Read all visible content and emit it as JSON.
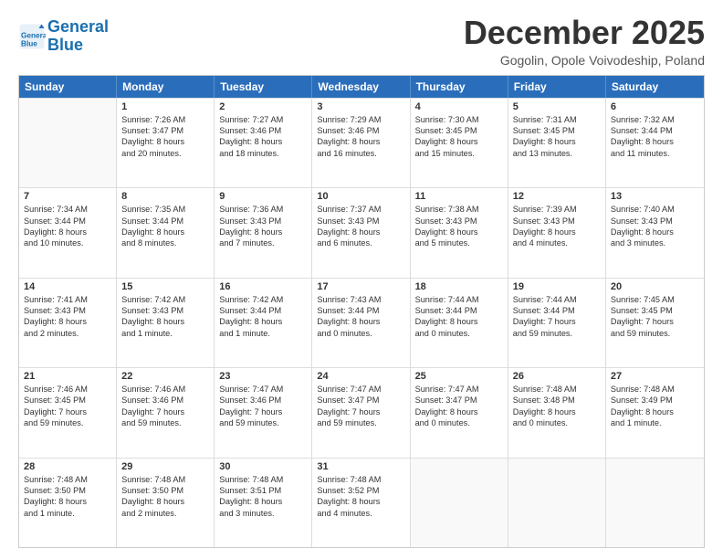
{
  "logo": {
    "line1": "General",
    "line2": "Blue"
  },
  "title": "December 2025",
  "location": "Gogolin, Opole Voivodeship, Poland",
  "days": [
    "Sunday",
    "Monday",
    "Tuesday",
    "Wednesday",
    "Thursday",
    "Friday",
    "Saturday"
  ],
  "weeks": [
    [
      {
        "day": "",
        "sunrise": "",
        "sunset": "",
        "daylight": ""
      },
      {
        "day": "1",
        "sunrise": "Sunrise: 7:26 AM",
        "sunset": "Sunset: 3:47 PM",
        "daylight": "Daylight: 8 hours",
        "daylight2": "and 20 minutes."
      },
      {
        "day": "2",
        "sunrise": "Sunrise: 7:27 AM",
        "sunset": "Sunset: 3:46 PM",
        "daylight": "Daylight: 8 hours",
        "daylight2": "and 18 minutes."
      },
      {
        "day": "3",
        "sunrise": "Sunrise: 7:29 AM",
        "sunset": "Sunset: 3:46 PM",
        "daylight": "Daylight: 8 hours",
        "daylight2": "and 16 minutes."
      },
      {
        "day": "4",
        "sunrise": "Sunrise: 7:30 AM",
        "sunset": "Sunset: 3:45 PM",
        "daylight": "Daylight: 8 hours",
        "daylight2": "and 15 minutes."
      },
      {
        "day": "5",
        "sunrise": "Sunrise: 7:31 AM",
        "sunset": "Sunset: 3:45 PM",
        "daylight": "Daylight: 8 hours",
        "daylight2": "and 13 minutes."
      },
      {
        "day": "6",
        "sunrise": "Sunrise: 7:32 AM",
        "sunset": "Sunset: 3:44 PM",
        "daylight": "Daylight: 8 hours",
        "daylight2": "and 11 minutes."
      }
    ],
    [
      {
        "day": "7",
        "sunrise": "Sunrise: 7:34 AM",
        "sunset": "Sunset: 3:44 PM",
        "daylight": "Daylight: 8 hours",
        "daylight2": "and 10 minutes."
      },
      {
        "day": "8",
        "sunrise": "Sunrise: 7:35 AM",
        "sunset": "Sunset: 3:44 PM",
        "daylight": "Daylight: 8 hours",
        "daylight2": "and 8 minutes."
      },
      {
        "day": "9",
        "sunrise": "Sunrise: 7:36 AM",
        "sunset": "Sunset: 3:43 PM",
        "daylight": "Daylight: 8 hours",
        "daylight2": "and 7 minutes."
      },
      {
        "day": "10",
        "sunrise": "Sunrise: 7:37 AM",
        "sunset": "Sunset: 3:43 PM",
        "daylight": "Daylight: 8 hours",
        "daylight2": "and 6 minutes."
      },
      {
        "day": "11",
        "sunrise": "Sunrise: 7:38 AM",
        "sunset": "Sunset: 3:43 PM",
        "daylight": "Daylight: 8 hours",
        "daylight2": "and 5 minutes."
      },
      {
        "day": "12",
        "sunrise": "Sunrise: 7:39 AM",
        "sunset": "Sunset: 3:43 PM",
        "daylight": "Daylight: 8 hours",
        "daylight2": "and 4 minutes."
      },
      {
        "day": "13",
        "sunrise": "Sunrise: 7:40 AM",
        "sunset": "Sunset: 3:43 PM",
        "daylight": "Daylight: 8 hours",
        "daylight2": "and 3 minutes."
      }
    ],
    [
      {
        "day": "14",
        "sunrise": "Sunrise: 7:41 AM",
        "sunset": "Sunset: 3:43 PM",
        "daylight": "Daylight: 8 hours",
        "daylight2": "and 2 minutes."
      },
      {
        "day": "15",
        "sunrise": "Sunrise: 7:42 AM",
        "sunset": "Sunset: 3:43 PM",
        "daylight": "Daylight: 8 hours",
        "daylight2": "and 1 minute."
      },
      {
        "day": "16",
        "sunrise": "Sunrise: 7:42 AM",
        "sunset": "Sunset: 3:44 PM",
        "daylight": "Daylight: 8 hours",
        "daylight2": "and 1 minute."
      },
      {
        "day": "17",
        "sunrise": "Sunrise: 7:43 AM",
        "sunset": "Sunset: 3:44 PM",
        "daylight": "Daylight: 8 hours",
        "daylight2": "and 0 minutes."
      },
      {
        "day": "18",
        "sunrise": "Sunrise: 7:44 AM",
        "sunset": "Sunset: 3:44 PM",
        "daylight": "Daylight: 8 hours",
        "daylight2": "and 0 minutes."
      },
      {
        "day": "19",
        "sunrise": "Sunrise: 7:44 AM",
        "sunset": "Sunset: 3:44 PM",
        "daylight": "Daylight: 7 hours",
        "daylight2": "and 59 minutes."
      },
      {
        "day": "20",
        "sunrise": "Sunrise: 7:45 AM",
        "sunset": "Sunset: 3:45 PM",
        "daylight": "Daylight: 7 hours",
        "daylight2": "and 59 minutes."
      }
    ],
    [
      {
        "day": "21",
        "sunrise": "Sunrise: 7:46 AM",
        "sunset": "Sunset: 3:45 PM",
        "daylight": "Daylight: 7 hours",
        "daylight2": "and 59 minutes."
      },
      {
        "day": "22",
        "sunrise": "Sunrise: 7:46 AM",
        "sunset": "Sunset: 3:46 PM",
        "daylight": "Daylight: 7 hours",
        "daylight2": "and 59 minutes."
      },
      {
        "day": "23",
        "sunrise": "Sunrise: 7:47 AM",
        "sunset": "Sunset: 3:46 PM",
        "daylight": "Daylight: 7 hours",
        "daylight2": "and 59 minutes."
      },
      {
        "day": "24",
        "sunrise": "Sunrise: 7:47 AM",
        "sunset": "Sunset: 3:47 PM",
        "daylight": "Daylight: 7 hours",
        "daylight2": "and 59 minutes."
      },
      {
        "day": "25",
        "sunrise": "Sunrise: 7:47 AM",
        "sunset": "Sunset: 3:47 PM",
        "daylight": "Daylight: 8 hours",
        "daylight2": "and 0 minutes."
      },
      {
        "day": "26",
        "sunrise": "Sunrise: 7:48 AM",
        "sunset": "Sunset: 3:48 PM",
        "daylight": "Daylight: 8 hours",
        "daylight2": "and 0 minutes."
      },
      {
        "day": "27",
        "sunrise": "Sunrise: 7:48 AM",
        "sunset": "Sunset: 3:49 PM",
        "daylight": "Daylight: 8 hours",
        "daylight2": "and 1 minute."
      }
    ],
    [
      {
        "day": "28",
        "sunrise": "Sunrise: 7:48 AM",
        "sunset": "Sunset: 3:50 PM",
        "daylight": "Daylight: 8 hours",
        "daylight2": "and 1 minute."
      },
      {
        "day": "29",
        "sunrise": "Sunrise: 7:48 AM",
        "sunset": "Sunset: 3:50 PM",
        "daylight": "Daylight: 8 hours",
        "daylight2": "and 2 minutes."
      },
      {
        "day": "30",
        "sunrise": "Sunrise: 7:48 AM",
        "sunset": "Sunset: 3:51 PM",
        "daylight": "Daylight: 8 hours",
        "daylight2": "and 3 minutes."
      },
      {
        "day": "31",
        "sunrise": "Sunrise: 7:48 AM",
        "sunset": "Sunset: 3:52 PM",
        "daylight": "Daylight: 8 hours",
        "daylight2": "and 4 minutes."
      },
      {
        "day": "",
        "sunrise": "",
        "sunset": "",
        "daylight": "",
        "daylight2": ""
      },
      {
        "day": "",
        "sunrise": "",
        "sunset": "",
        "daylight": "",
        "daylight2": ""
      },
      {
        "day": "",
        "sunrise": "",
        "sunset": "",
        "daylight": "",
        "daylight2": ""
      }
    ]
  ]
}
